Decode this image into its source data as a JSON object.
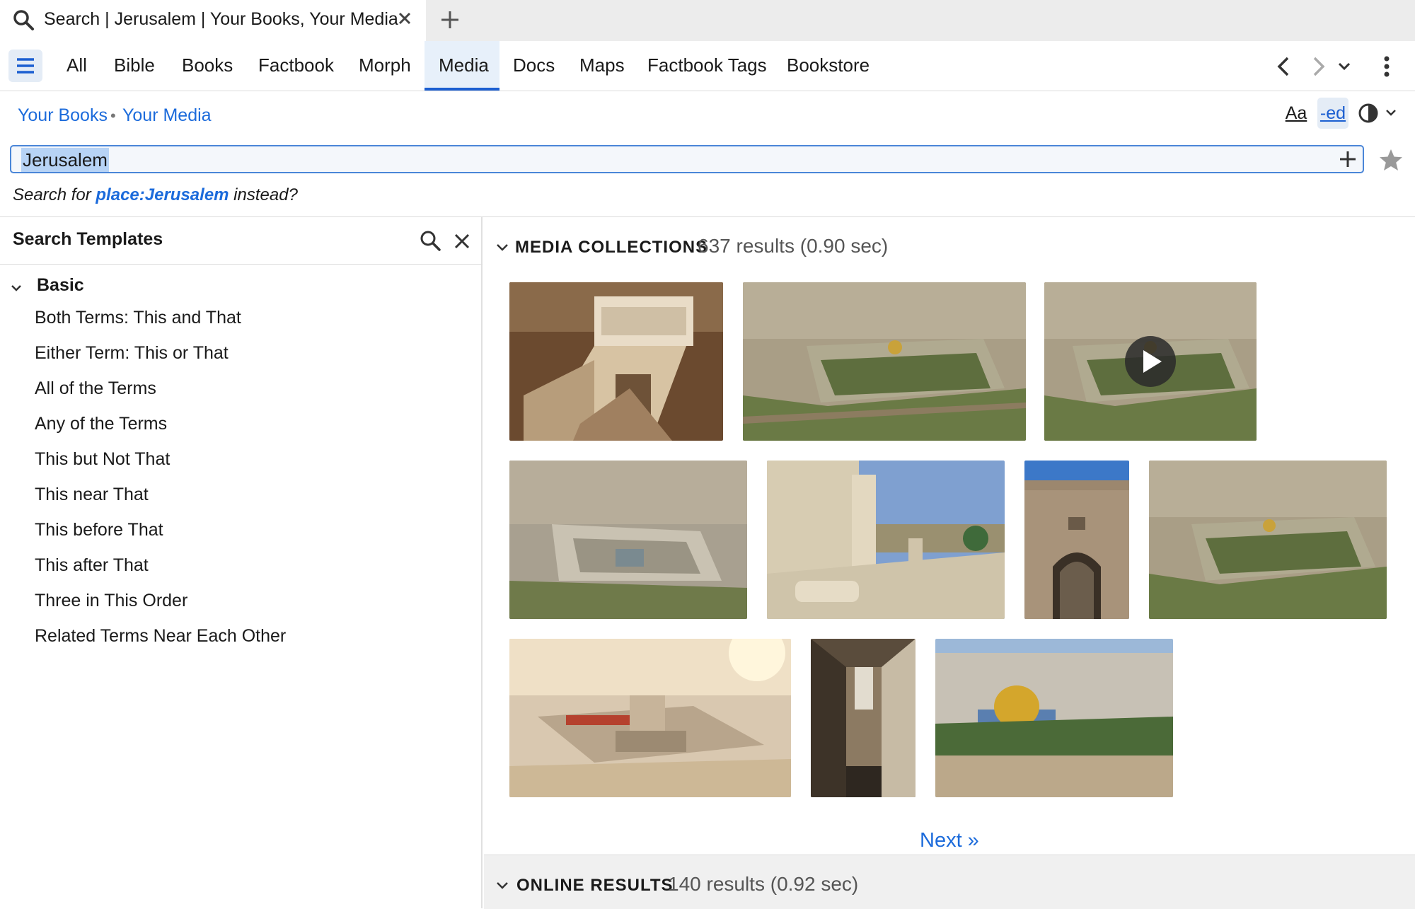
{
  "tab": {
    "title": "Search | Jerusalem | Your Books, Your Media"
  },
  "nav": {
    "tabs": [
      "All",
      "Bible",
      "Books",
      "Factbook",
      "Morph",
      "Media",
      "Docs",
      "Maps",
      "Factbook Tags",
      "Bookstore"
    ],
    "active": "Media"
  },
  "breadcrumb": {
    "first": "Your Books",
    "separator": "•",
    "second": "Your Media"
  },
  "tools": {
    "font": "Aa",
    "edit": "-ed"
  },
  "search": {
    "value": "Jerusalem"
  },
  "suggestion": {
    "prefix": "Search for",
    "link": "place:Jerusalem",
    "suffix": "instead?"
  },
  "templates": {
    "title": "Search Templates",
    "group": "Basic",
    "items": [
      "Both Terms: This and That",
      "Either Term: This or That",
      "All of the Terms",
      "Any of the Terms",
      "This but Not That",
      "This near That",
      "This before That",
      "This after That",
      "Three in This Order",
      "Related Terms Near Each Other"
    ]
  },
  "media": {
    "title": "MEDIA COLLECTIONS",
    "count": "637 results (0.90 sec)",
    "thumbnails": [
      {
        "name": "temple-stairs-model",
        "video": false
      },
      {
        "name": "temple-mount-aerial",
        "video": false
      },
      {
        "name": "temple-mount-aerial-video",
        "video": true
      },
      {
        "name": "herodian-temple-aerial",
        "video": false
      },
      {
        "name": "ancient-columns-ruins",
        "video": false
      },
      {
        "name": "city-gate",
        "video": false
      },
      {
        "name": "temple-mount-aerial-wide",
        "video": false
      },
      {
        "name": "temple-reconstruction-sunset",
        "video": false
      },
      {
        "name": "narrow-alley",
        "video": false
      },
      {
        "name": "dome-of-the-rock",
        "video": false
      }
    ]
  },
  "pagination": {
    "next": "Next »"
  },
  "online": {
    "title": "ONLINE RESULTS",
    "count": "140 results (0.92 sec)"
  },
  "colors": {
    "accent": "#1c5fd1",
    "link": "#1c6bdb",
    "highlight": "#b7d3f5"
  }
}
